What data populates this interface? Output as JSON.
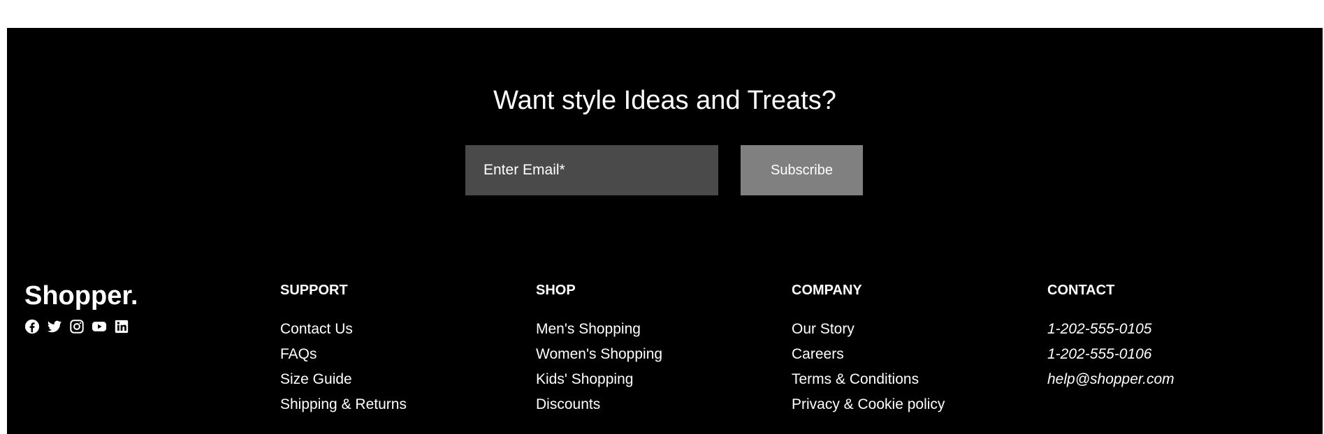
{
  "newsletter": {
    "title": "Want style Ideas and Treats?",
    "email_placeholder": "Enter Email*",
    "subscribe_label": "Subscribe"
  },
  "brand": {
    "name": "Shopper.",
    "social_icons": [
      "facebook-icon",
      "twitter-icon",
      "instagram-icon",
      "youtube-icon",
      "linkedin-icon"
    ]
  },
  "columns": {
    "support": {
      "heading": "SUPPORT",
      "links": [
        "Contact Us",
        "FAQs",
        "Size Guide",
        "Shipping & Returns"
      ]
    },
    "shop": {
      "heading": "SHOP",
      "links": [
        "Men's Shopping",
        "Women's Shopping",
        "Kids' Shopping",
        "Discounts"
      ]
    },
    "company": {
      "heading": "COMPANY",
      "links": [
        "Our Story",
        "Careers",
        "Terms & Conditions",
        "Privacy & Cookie policy"
      ]
    },
    "contact": {
      "heading": "CONTACT",
      "items": [
        "1-202-555-0105",
        "1-202-555-0106",
        "help@shopper.com"
      ]
    }
  },
  "colors": {
    "background": "#000000",
    "input_background": "#4a4a4a",
    "button_background": "#808080",
    "text": "#ffffff"
  }
}
